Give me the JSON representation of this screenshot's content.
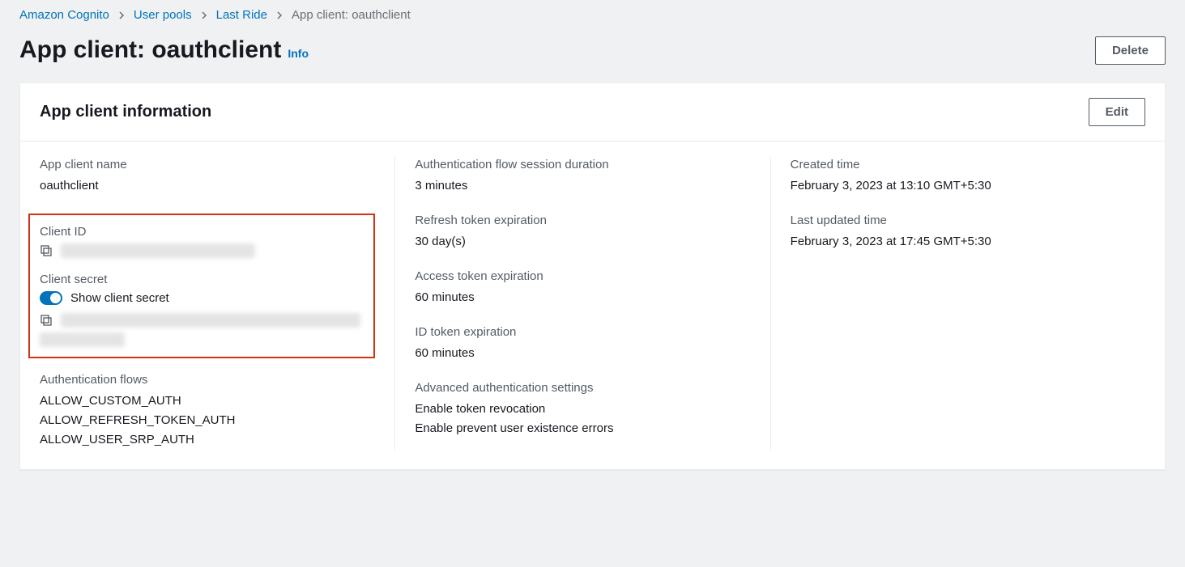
{
  "breadcrumb": {
    "items": [
      {
        "label": "Amazon Cognito"
      },
      {
        "label": "User pools"
      },
      {
        "label": "Last Ride"
      }
    ],
    "current": "App client: oauthclient"
  },
  "header": {
    "title": "App client: oauthclient",
    "info_label": "Info",
    "delete_label": "Delete"
  },
  "panel": {
    "title": "App client information",
    "edit_label": "Edit"
  },
  "col1": {
    "app_client_name": {
      "label": "App client name",
      "value": "oauthclient"
    },
    "client_id": {
      "label": "Client ID",
      "value": ""
    },
    "client_secret": {
      "label": "Client secret",
      "toggle_label": "Show client secret",
      "value": ""
    },
    "auth_flows": {
      "label": "Authentication flows",
      "values": [
        "ALLOW_CUSTOM_AUTH",
        "ALLOW_REFRESH_TOKEN_AUTH",
        "ALLOW_USER_SRP_AUTH"
      ]
    }
  },
  "col2": {
    "session_duration": {
      "label": "Authentication flow session duration",
      "value": "3 minutes"
    },
    "refresh_token": {
      "label": "Refresh token expiration",
      "value": "30 day(s)"
    },
    "access_token": {
      "label": "Access token expiration",
      "value": "60 minutes"
    },
    "id_token": {
      "label": "ID token expiration",
      "value": "60 minutes"
    },
    "advanced": {
      "label": "Advanced authentication settings",
      "values": [
        "Enable token revocation",
        "Enable prevent user existence errors"
      ]
    }
  },
  "col3": {
    "created": {
      "label": "Created time",
      "value": "February 3, 2023 at 13:10 GMT+5:30"
    },
    "updated": {
      "label": "Last updated time",
      "value": "February 3, 2023 at 17:45 GMT+5:30"
    }
  }
}
